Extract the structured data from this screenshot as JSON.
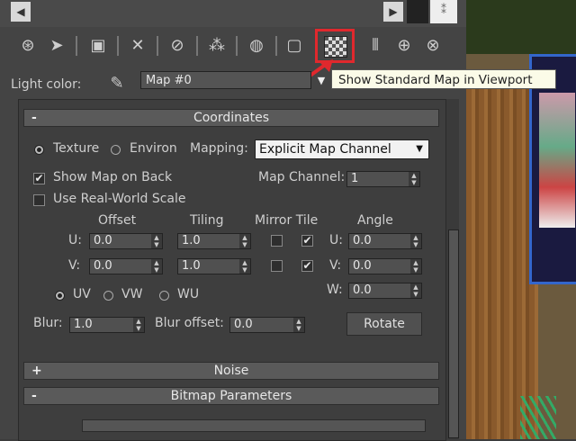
{
  "toolbar": {
    "icons": [
      "get-material-icon",
      "assign-material-icon",
      "put-library-icon",
      "delete-icon",
      "copy-material-icon",
      "make-unique-icon",
      "material-id-icon",
      "sample-slot-icon",
      "show-map-viewport-icon",
      "show-end-result-icon",
      "go-parent-icon",
      "go-sibling-icon"
    ],
    "highlighted": "show-map-viewport-icon",
    "highlight_color": "#e0282d"
  },
  "tooltip": "Show Standard Map in Viewport",
  "light_color": {
    "label": "Light color:",
    "map_name": "Map #0"
  },
  "coordinates": {
    "sign": "-",
    "title": "Coordinates",
    "texture_label": "Texture",
    "environ_label": "Environ",
    "mapping_label": "Mapping:",
    "mapping_value": "Explicit Map Channel",
    "show_map_on_back": "Show Map on Back",
    "map_channel_label": "Map Channel:",
    "map_channel_value": "1",
    "real_world_scale": "Use Real-World Scale",
    "headers": {
      "offset": "Offset",
      "tiling": "Tiling",
      "mirror_tile": "Mirror Tile",
      "angle": "Angle"
    },
    "u_label": "U:",
    "v_label": "V:",
    "w_label": "W:",
    "u_offset": "0.0",
    "v_offset": "0.0",
    "u_tiling": "1.0",
    "v_tiling": "1.0",
    "u_angle": "0.0",
    "v_angle": "0.0",
    "w_angle": "0.0",
    "uv_label": "UV",
    "vw_label": "VW",
    "wu_label": "WU",
    "blur_label": "Blur:",
    "blur_value": "1.0",
    "blur_offset_label": "Blur offset:",
    "blur_offset_value": "0.0",
    "rotate_label": "Rotate"
  },
  "noise": {
    "sign": "+",
    "title": "Noise"
  },
  "bitmap": {
    "sign": "-",
    "title": "Bitmap Parameters"
  }
}
